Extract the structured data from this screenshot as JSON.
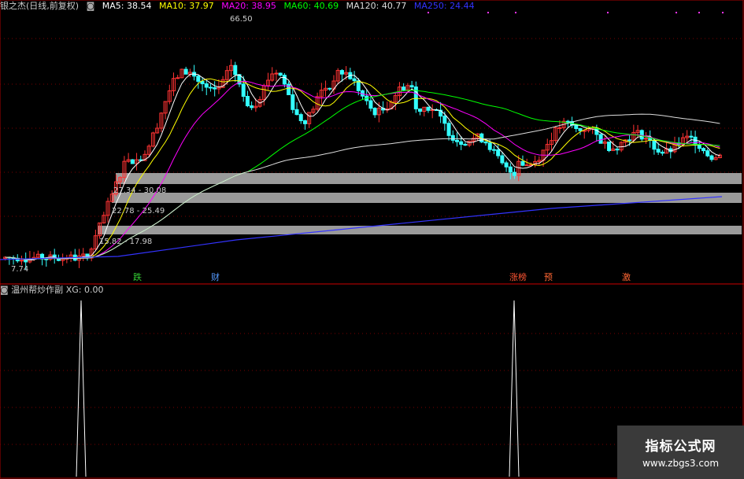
{
  "header": {
    "stock": "银之杰(日线,前复权)",
    "ma5": "MA5: 38.54",
    "ma10": "MA10: 37.97",
    "ma20": "MA20: 38.95",
    "ma60": "MA60: 40.69",
    "ma120": "MA120: 40.77",
    "ma250": "MA250: 24.44",
    "colors": {
      "ma5": "#ffffff",
      "ma10": "#ffff00",
      "ma20": "#ff00ff",
      "ma60": "#00ff00",
      "ma120": "#dddddd",
      "ma250": "#3333ff"
    }
  },
  "price_labels": {
    "high": "66.50",
    "low": "7.74"
  },
  "zones": [
    {
      "label": "27.34 - 30.08",
      "low": 27.34,
      "high": 30.08
    },
    {
      "label": "22.78 - 25.49",
      "low": 22.78,
      "high": 25.49
    },
    {
      "label": "15.82 - 17.98",
      "low": 15.82,
      "high": 17.98
    }
  ],
  "event_tags": [
    {
      "text": "跌",
      "color": "#33cc33"
    },
    {
      "text": "财",
      "color": "#5599ff"
    },
    {
      "text": "涨榜",
      "color": "#ff5533"
    },
    {
      "text": "预",
      "color": "#ff6633"
    },
    {
      "text": "激",
      "color": "#ff6633"
    }
  ],
  "sub_panel": {
    "title": "温州帮炒作副",
    "xg": "XG: 0.00"
  },
  "watermark": {
    "line1": "指标公式网",
    "line2": "www.zbgs3.com"
  },
  "chart_data": {
    "type": "candlestick",
    "price_range": [
      7.74,
      66.5
    ],
    "ma_values": {
      "MA5": 38.54,
      "MA10": 37.97,
      "MA20": 38.95,
      "MA60": 40.69,
      "MA120": 40.77,
      "MA250": 24.44
    },
    "sub_indicator": {
      "name": "XG",
      "value": 0.0,
      "signal_peaks": 2
    }
  }
}
